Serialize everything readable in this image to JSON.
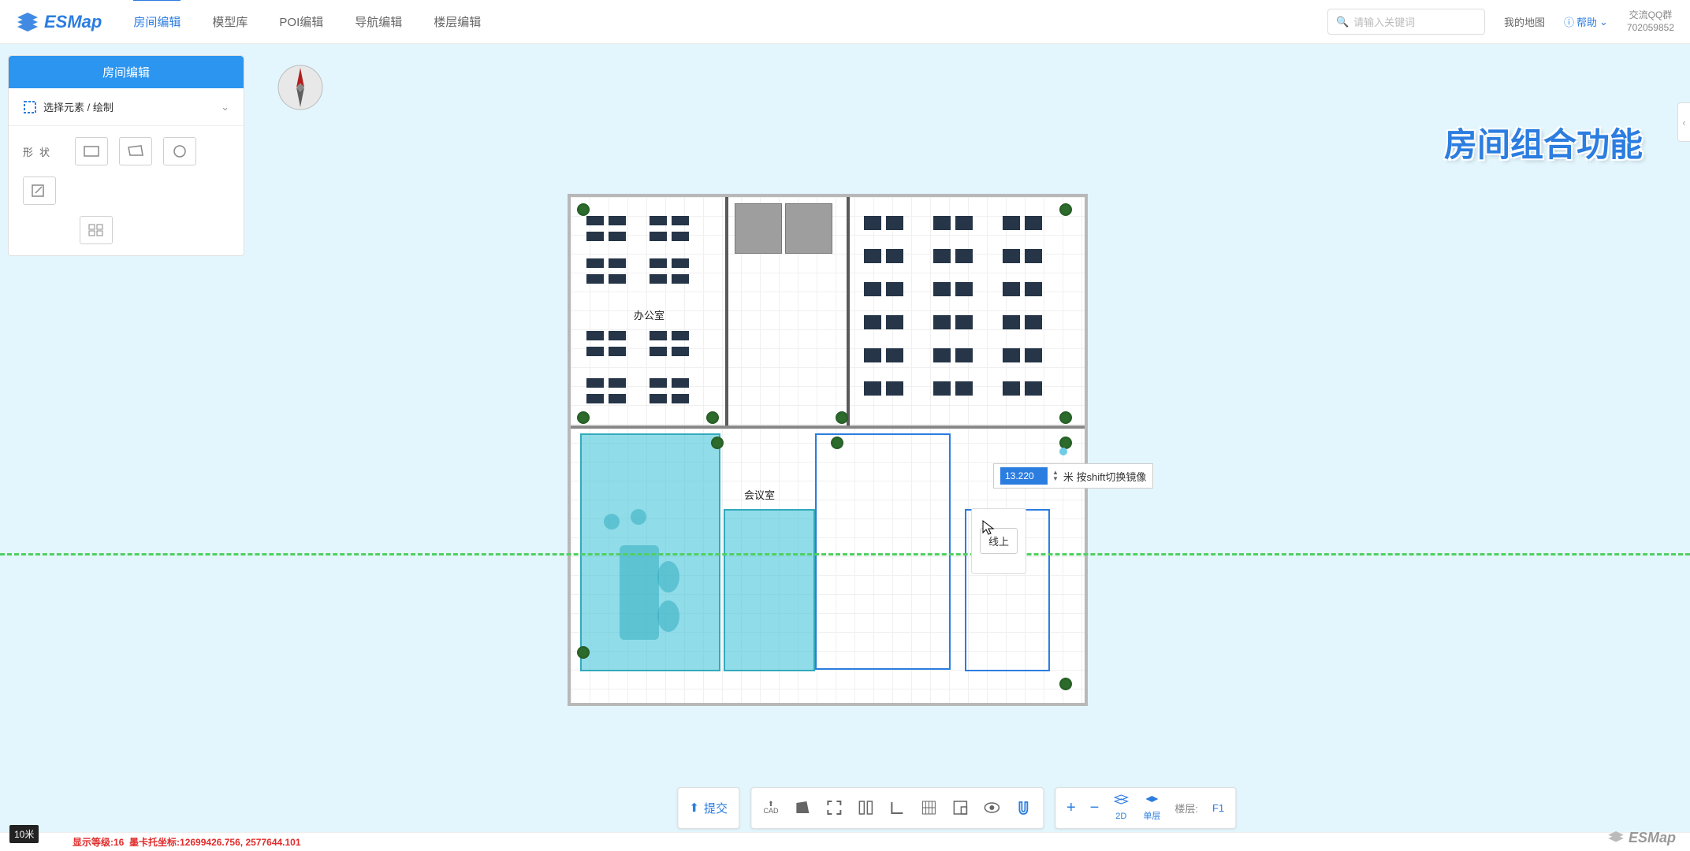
{
  "brand": "ESMap",
  "nav": {
    "tabs": [
      "房间编辑",
      "模型库",
      "POI编辑",
      "导航编辑",
      "楼层编辑"
    ],
    "active_index": 0
  },
  "search": {
    "placeholder": "请输入关键词"
  },
  "header": {
    "my_maps": "我的地图",
    "help": "帮助",
    "qq_label": "交流QQ群",
    "qq_number": "702059852"
  },
  "left_panel": {
    "title": "房间编辑",
    "section1": "选择元素 / 绘制",
    "shapes_label": "形状"
  },
  "watermark": "房间组合功能",
  "floorplan": {
    "office_label": "办公室",
    "meeting_label": "会议室"
  },
  "measure": {
    "value": "13.220",
    "unit_hint": "米 按shift切换镜像"
  },
  "tooltip": {
    "text": "线上"
  },
  "bottom": {
    "submit": "提交",
    "cad": "CAD",
    "view2d": "2D",
    "single_layer": "单层",
    "floor_label": "楼层:",
    "floor_value": "F1"
  },
  "status": {
    "scale": "10米",
    "level_label": "显示等级:",
    "level_value": "16",
    "coord_label": "墨卡托坐标:",
    "coord_value": "12699426.756, 2577644.101"
  },
  "watermark_logo": "ESMap"
}
